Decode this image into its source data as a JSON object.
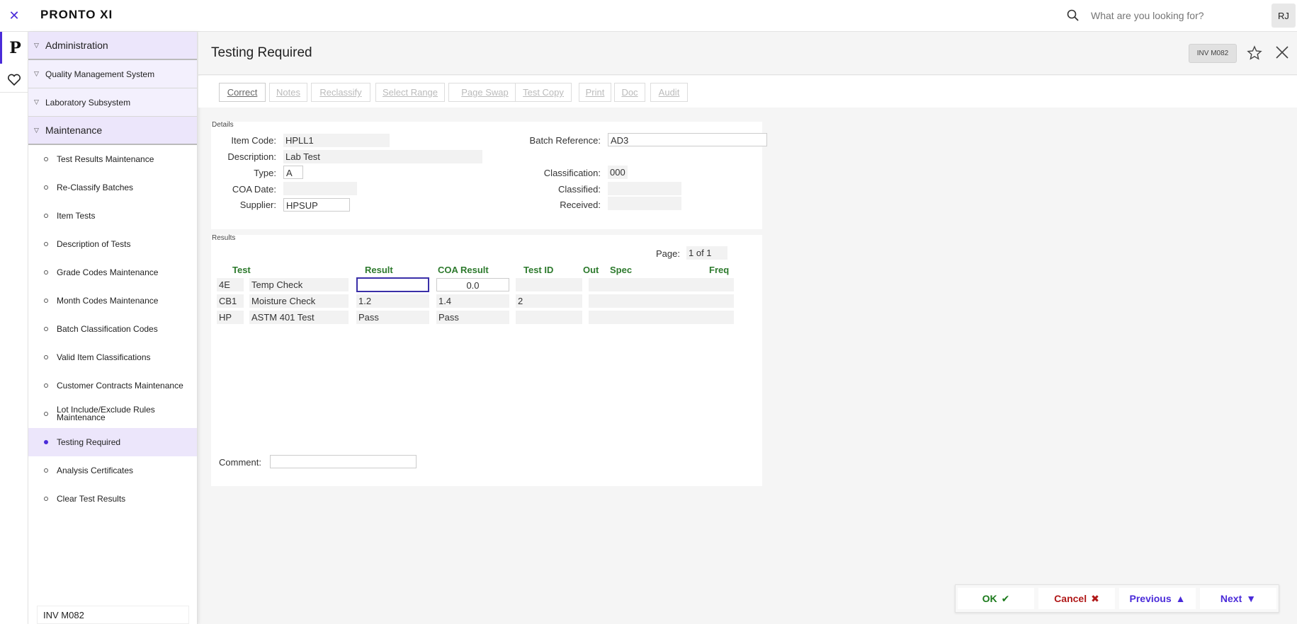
{
  "app": {
    "logo": "PRONTO XI",
    "search_placeholder": "What are you looking for?",
    "user_initials": "RJ"
  },
  "sidebar": {
    "sections": [
      {
        "label": "Administration"
      },
      {
        "label": "Quality Management System"
      },
      {
        "label": "Laboratory Subsystem"
      },
      {
        "label": "Maintenance"
      }
    ],
    "items": [
      {
        "label": "Test Results Maintenance"
      },
      {
        "label": "Re-Classify Batches"
      },
      {
        "label": "Item Tests"
      },
      {
        "label": "Description of Tests"
      },
      {
        "label": "Grade Codes Maintenance"
      },
      {
        "label": "Month Codes Maintenance"
      },
      {
        "label": "Batch Classification Codes"
      },
      {
        "label": "Valid Item Classifications"
      },
      {
        "label": "Customer Contracts Maintenance"
      },
      {
        "label": "Lot Include/Exclude Rules Maintenance"
      },
      {
        "label": "Testing Required"
      },
      {
        "label": "Analysis Certificates"
      },
      {
        "label": "Clear Test Results"
      }
    ],
    "footer_code": "INV M082"
  },
  "page": {
    "title": "Testing Required",
    "code_badge": "INV M082"
  },
  "toolbar": {
    "buttons": [
      "Correct",
      "Notes",
      "Reclassify",
      "Select Range",
      "Page Swap",
      "Test Copy",
      "Print",
      "Doc",
      "Audit"
    ]
  },
  "details": {
    "section_label": "Details",
    "item_code_label": "Item Code:",
    "item_code": "HPLL1",
    "description_label": "Description:",
    "description": "Lab Test",
    "type_label": "Type:",
    "type": "A",
    "coa_date_label": "COA Date:",
    "coa_date": "",
    "supplier_label": "Supplier:",
    "supplier": "HPSUP",
    "batch_ref_label": "Batch Reference:",
    "batch_ref": "AD3",
    "classification_label": "Classification:",
    "classification": "000",
    "classified_label": "Classified:",
    "classified": "",
    "received_label": "Received:",
    "received": ""
  },
  "results": {
    "section_label": "Results",
    "page_label": "Page:",
    "page_value": "1 of 1",
    "headers": {
      "test": "Test",
      "result": "Result",
      "coa_result": "COA Result",
      "test_id": "Test ID",
      "out": "Out",
      "spec": "Spec",
      "freq": "Freq"
    },
    "rows": [
      {
        "code": "4E",
        "name": "Temp Check",
        "result": "",
        "coa": "0.0",
        "test_id": ""
      },
      {
        "code": "CB1",
        "name": "Moisture Check",
        "result": "1.2",
        "coa": "1.4",
        "test_id": "2"
      },
      {
        "code": "HP",
        "name": "ASTM 401 Test",
        "result": "Pass",
        "coa": "Pass",
        "test_id": ""
      }
    ],
    "comment_label": "Comment:",
    "comment": ""
  },
  "actions": {
    "ok": "OK",
    "cancel": "Cancel",
    "previous": "Previous",
    "next": "Next"
  }
}
